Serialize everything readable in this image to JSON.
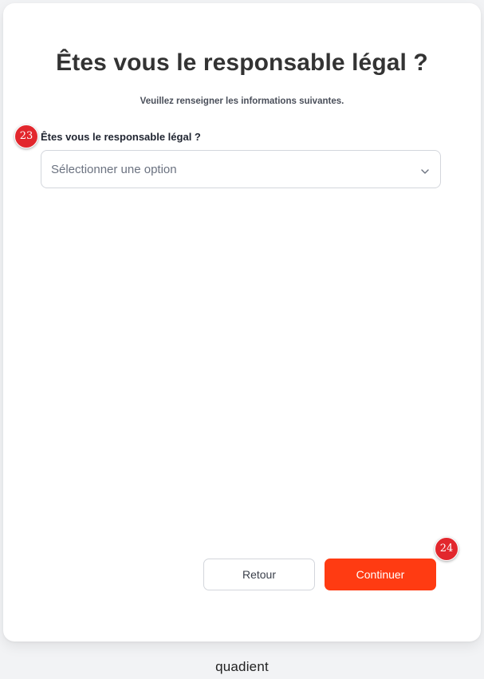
{
  "page": {
    "title": "Êtes vous le responsable légal ?",
    "subtitle": "Veuillez renseigner les informations suivantes."
  },
  "form": {
    "field_label": "Êtes vous le responsable légal ?",
    "select_placeholder": "Sélectionner une option"
  },
  "badges": {
    "field": "23",
    "continue": "24"
  },
  "actions": {
    "back_label": "Retour",
    "continue_label": "Continuer"
  },
  "footer": {
    "logo_text": "quadient"
  },
  "colors": {
    "accent": "#ff3b12",
    "badge": "#e2272d"
  },
  "icons": {
    "select_chevron": "chevron-down-icon"
  }
}
